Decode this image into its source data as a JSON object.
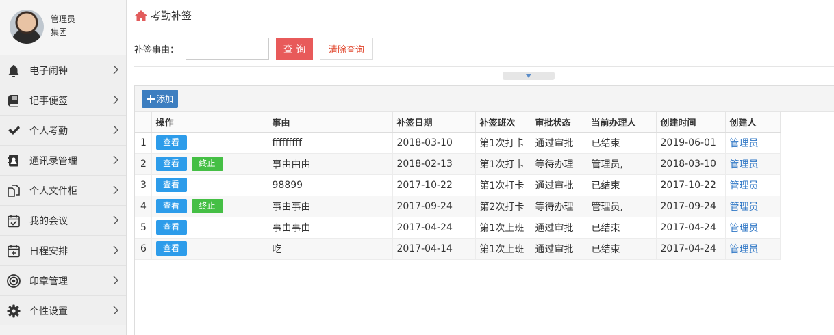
{
  "user": {
    "name": "管理员",
    "org": "集团"
  },
  "sidebar": {
    "items": [
      {
        "label": "电子闹钟",
        "icon": "bell-icon"
      },
      {
        "label": "记事便签",
        "icon": "notebook-icon"
      },
      {
        "label": "个人考勤",
        "icon": "checkmark-icon"
      },
      {
        "label": "通讯录管理",
        "icon": "contact-book-icon"
      },
      {
        "label": "个人文件柜",
        "icon": "files-icon"
      },
      {
        "label": "我的会议",
        "icon": "calendar-check-icon"
      },
      {
        "label": "日程安排",
        "icon": "calendar-add-icon"
      },
      {
        "label": "印章管理",
        "icon": "seal-icon"
      },
      {
        "label": "个性设置",
        "icon": "gear-icon"
      }
    ]
  },
  "breadcrumb": {
    "title": "考勤补签"
  },
  "filter": {
    "label": "补签事由：",
    "value": "",
    "query_label": "查 询",
    "clear_label": "清除查询"
  },
  "toolbar": {
    "add_label": "添加"
  },
  "table": {
    "headers": [
      "",
      "操作",
      "事由",
      "补签日期",
      "补签班次",
      "审批状态",
      "当前办理人",
      "创建时间",
      "创建人"
    ],
    "view_label": "查看",
    "stop_label": "终止",
    "rows": [
      {
        "num": "1",
        "stop": false,
        "reason": "fffffffff",
        "date": "2018-03-10",
        "shift": "第1次打卡",
        "status": "通过审批",
        "handler": "已结束",
        "created": "2019-06-01",
        "creator": "管理员"
      },
      {
        "num": "2",
        "stop": true,
        "reason": "事由由由",
        "date": "2018-02-13",
        "shift": "第1次打卡",
        "status": "等待办理",
        "handler": "管理员,",
        "created": "2018-03-10",
        "creator": "管理员"
      },
      {
        "num": "3",
        "stop": false,
        "reason": "98899",
        "date": "2017-10-22",
        "shift": "第1次打卡",
        "status": "通过审批",
        "handler": "已结束",
        "created": "2017-10-22",
        "creator": "管理员"
      },
      {
        "num": "4",
        "stop": true,
        "reason": "事由事由",
        "date": "2017-09-24",
        "shift": "第2次打卡",
        "status": "等待办理",
        "handler": "管理员,",
        "created": "2017-09-24",
        "creator": "管理员"
      },
      {
        "num": "5",
        "stop": false,
        "reason": "事由事由",
        "date": "2017-04-24",
        "shift": "第1次上班",
        "status": "通过审批",
        "handler": "已结束",
        "created": "2017-04-24",
        "creator": "管理员"
      },
      {
        "num": "6",
        "stop": false,
        "reason": "吃",
        "date": "2017-04-14",
        "shift": "第1次上班",
        "status": "通过审批",
        "handler": "已结束",
        "created": "2017-04-24",
        "creator": "管理员"
      }
    ]
  }
}
